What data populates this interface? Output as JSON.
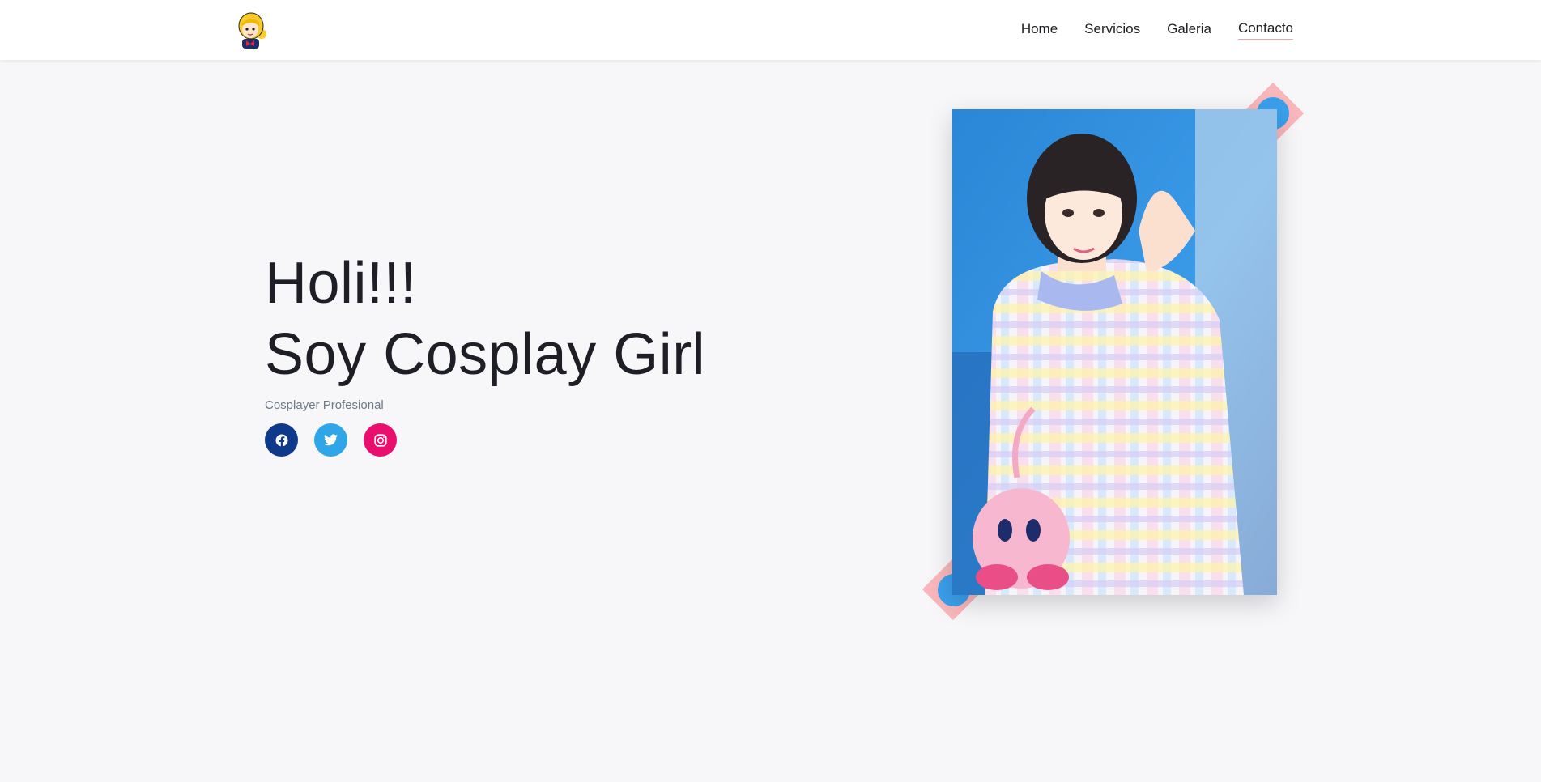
{
  "header": {
    "logo_icon": "cosplay-girl-logo-icon",
    "nav": [
      {
        "label": "Home",
        "active": false
      },
      {
        "label": "Servicios",
        "active": false
      },
      {
        "label": "Galeria",
        "active": false
      },
      {
        "label": "Contacto",
        "active": true
      }
    ]
  },
  "hero": {
    "title_line1": "Holi!!!",
    "title_line2": "Soy Cosplay Girl",
    "subtitle": "Cosplayer Profesional",
    "socials": [
      {
        "icon": "facebook-icon",
        "color": "#0f3a8c"
      },
      {
        "icon": "twitter-icon",
        "color": "#2fa6e8"
      },
      {
        "icon": "instagram-icon",
        "color": "#ea0f6f"
      }
    ]
  },
  "colors": {
    "accent_pink": "#f9b7bb",
    "accent_blue": "#3aa0ec",
    "background": "#f7f7f9"
  }
}
